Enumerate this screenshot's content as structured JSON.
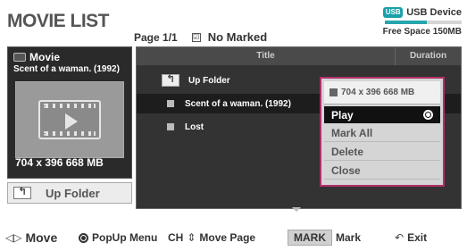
{
  "header": {
    "title": "MOVIE LIST",
    "page": "Page 1/1",
    "checkbox_glyph": "☑",
    "marked_status": "No Marked"
  },
  "device": {
    "badge": "USB",
    "name": "USB Device",
    "free_space": "Free Space 150MB",
    "free_fraction": 0.55,
    "accent_color": "#27a6ad"
  },
  "preview": {
    "category": "Movie",
    "selected_title": "Scent of a waman. (1992)",
    "resolution": "704 x 396 668 MB",
    "icon": "film-icon"
  },
  "up_folder_button": {
    "label": "Up Folder",
    "icon": "up-folder-icon"
  },
  "list": {
    "columns": {
      "title": "Title",
      "duration": "Duration"
    },
    "rows": [
      {
        "label": "Up Folder",
        "type": "folder"
      },
      {
        "label": "Scent of a waman. (1992)",
        "type": "file",
        "selected": true
      },
      {
        "label": "Lost",
        "type": "file"
      }
    ]
  },
  "popup": {
    "info": "704 x 396  668 MB",
    "items": [
      {
        "label": "Play",
        "active": true
      },
      {
        "label": "Mark All"
      },
      {
        "label": "Delete"
      },
      {
        "label": "Close"
      }
    ],
    "border_color": "#b0306a"
  },
  "footer": {
    "move": "Move",
    "popup_menu": "PopUp Menu",
    "ch": "CH",
    "move_page": "Move Page",
    "mark_key": "MARK",
    "mark": "Mark",
    "exit": "Exit"
  }
}
